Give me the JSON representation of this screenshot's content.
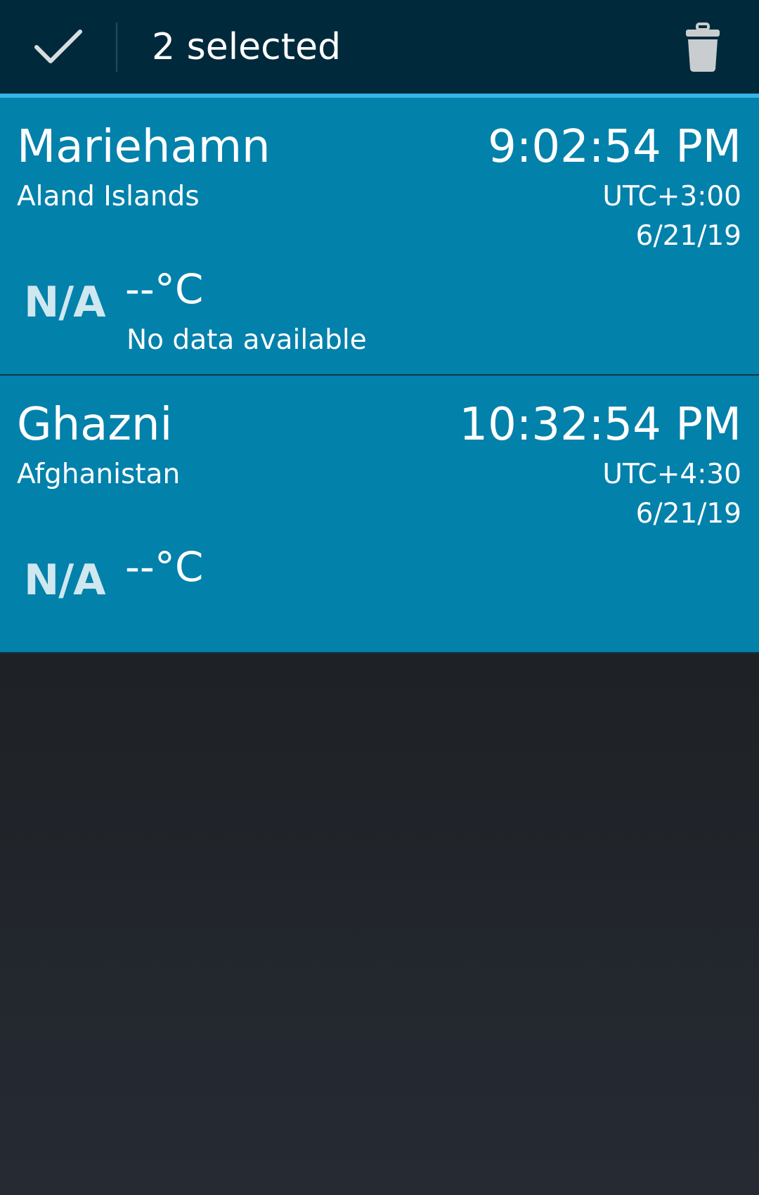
{
  "action_bar": {
    "title": "2 selected",
    "done_icon": "checkmark-icon",
    "delete_icon": "trash-icon"
  },
  "colors": {
    "action_bar_bg": "#002a3b",
    "accent_line": "#33b5e5",
    "selected_item_bg": "#0281ab",
    "background": "#1e2226"
  },
  "cities": [
    {
      "city": "Mariehamn",
      "country": "Aland Islands",
      "time": "9:02:54 PM",
      "utc_offset": "UTC+3:00",
      "date": "6/21/19",
      "weather_icon": "N/A",
      "temperature": "--°C",
      "condition": "No data available"
    },
    {
      "city": "Ghazni",
      "country": "Afghanistan",
      "time": "10:32:54 PM",
      "utc_offset": "UTC+4:30",
      "date": "6/21/19",
      "weather_icon": "N/A",
      "temperature": "--°C",
      "condition": ""
    }
  ]
}
